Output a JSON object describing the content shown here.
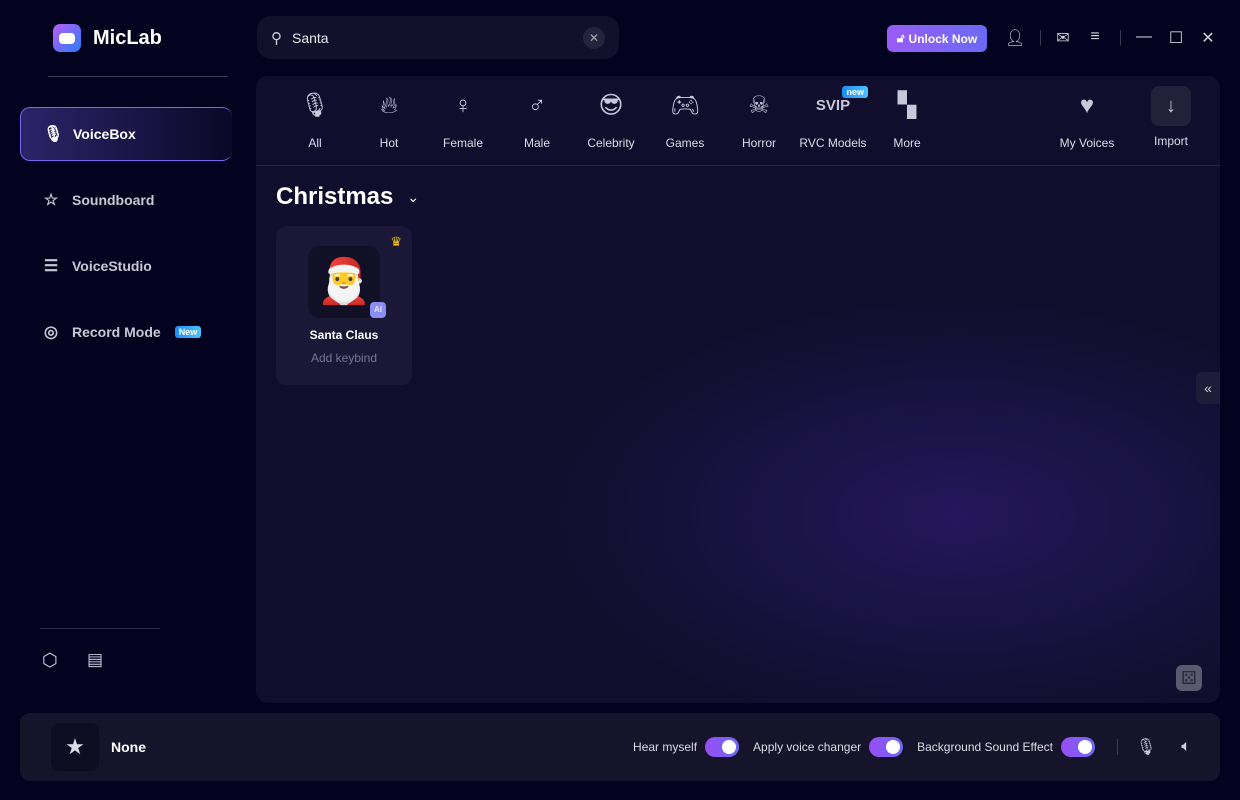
{
  "app": {
    "name": "MicLab"
  },
  "sidebar": {
    "items": [
      {
        "label": "VoiceBox",
        "icon": "mic-icon",
        "active": true
      },
      {
        "label": "Soundboard",
        "icon": "sparkle-star-icon"
      },
      {
        "label": "VoiceStudio",
        "icon": "sliders-icon"
      },
      {
        "label": "Record Mode",
        "icon": "waveform-circle-icon",
        "badge": "New"
      }
    ],
    "footer_icons": [
      "settings-hexagon-icon",
      "book-icon"
    ]
  },
  "search": {
    "value": "Santa",
    "placeholder": ""
  },
  "header": {
    "unlock_label": "Unlock Now"
  },
  "categories": [
    {
      "label": "All",
      "icon": "mic-icon"
    },
    {
      "label": "Hot",
      "icon": "flame-icon"
    },
    {
      "label": "Female",
      "icon": "female-icon"
    },
    {
      "label": "Male",
      "icon": "male-icon"
    },
    {
      "label": "Celebrity",
      "icon": "sunglasses-icon"
    },
    {
      "label": "Games",
      "icon": "gamepad-icon"
    },
    {
      "label": "Horror",
      "icon": "skull-icon"
    },
    {
      "label": "RVC Models",
      "icon": "svip-icon",
      "icon_text": "SVIP",
      "badge": "new"
    },
    {
      "label": "More",
      "icon": "grid-icon"
    }
  ],
  "right_actions": [
    {
      "label": "My Voices",
      "icon": "heart-icon"
    },
    {
      "label": "Import",
      "icon": "download-arrow-icon"
    }
  ],
  "section": {
    "title": "Christmas"
  },
  "voices": [
    {
      "name": "Santa Claus",
      "subtitle": "Add keybind",
      "badge": "AI",
      "premium": true
    }
  ],
  "bottom": {
    "current_voice": "None",
    "toggles": [
      {
        "label": "Hear myself",
        "on": true
      },
      {
        "label": "Apply voice changer",
        "on": true
      },
      {
        "label": "Background Sound Effect",
        "on": true
      }
    ]
  },
  "colors": {
    "accent": "#7a63f2",
    "background": "#04031f"
  }
}
